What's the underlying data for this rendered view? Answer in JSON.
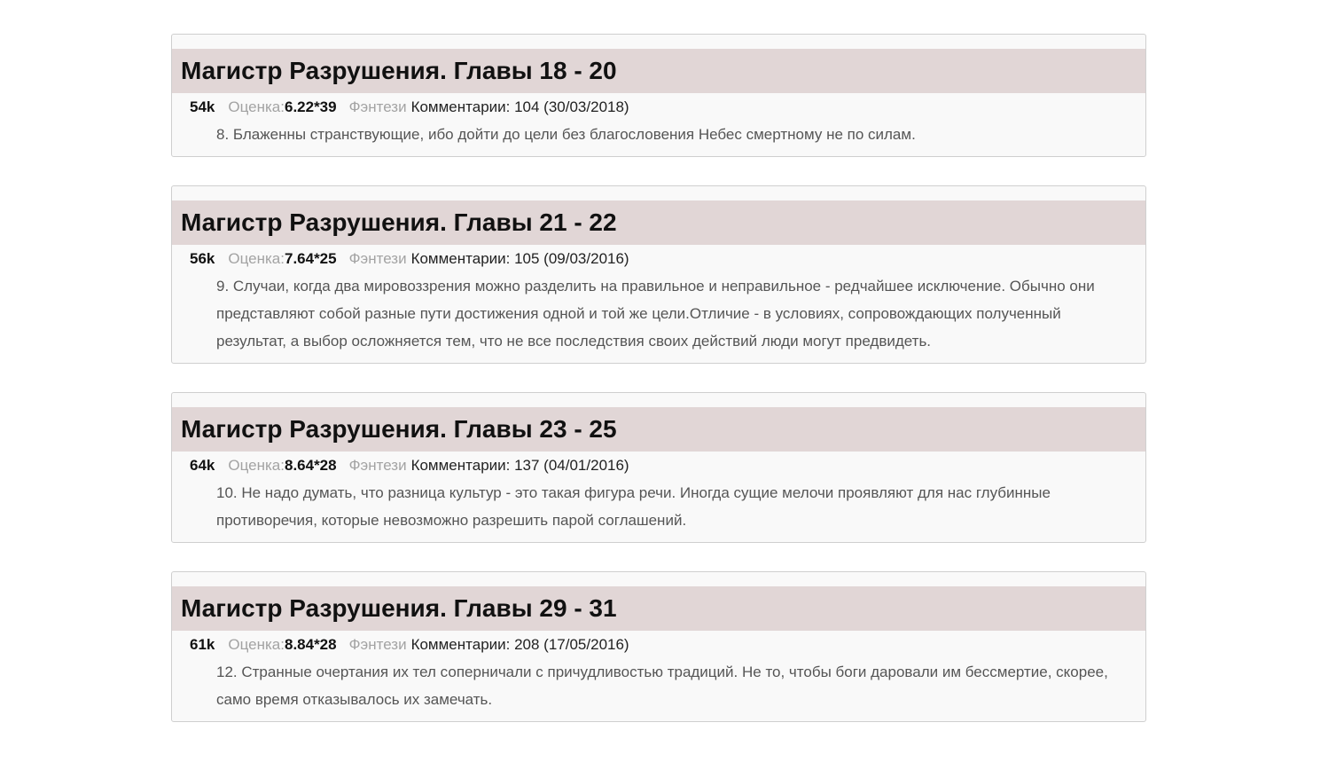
{
  "entries": [
    {
      "title": "Магистр Разрушения. Главы 18 - 20",
      "size": "54k",
      "rating_label": "Оценка:",
      "rating": "6.22*39",
      "genre": "Фэнтези",
      "comments": "Комментарии: 104 (30/03/2018)",
      "annotation": "8. Блаженны странствующие, ибо дойти до цели без благословения Небес смертному не по силам."
    },
    {
      "title": "Магистр Разрушения. Главы 21 - 22",
      "size": "56k",
      "rating_label": "Оценка:",
      "rating": "7.64*25",
      "genre": "Фэнтези",
      "comments": "Комментарии: 105 (09/03/2016)",
      "annotation": "9. Случаи, когда два мировоззрения можно разделить на правильное и неправильное - редчайшее исключение. Обычно они представляют собой разные пути достижения одной и той же цели.Отличие - в условиях, сопровождающих полученный результат, а выбор осложняется тем, что не все последствия своих действий люди могут предвидеть."
    },
    {
      "title": "Магистр Разрушения. Главы 23 - 25",
      "size": "64k",
      "rating_label": "Оценка:",
      "rating": "8.64*28",
      "genre": "Фэнтези",
      "comments": "Комментарии: 137 (04/01/2016)",
      "annotation": "10. Не надо думать, что разница культур - это такая фигура речи. Иногда сущие мелочи проявляют для нас глубинные противоречия, которые невозможно разрешить парой соглашений."
    },
    {
      "title": "Магистр Разрушения. Главы 29 - 31",
      "size": "61k",
      "rating_label": "Оценка:",
      "rating": "8.84*28",
      "genre": "Фэнтези",
      "comments": "Комментарии: 208 (17/05/2016)",
      "annotation": "12. Странные очертания их тел соперничали с причудливостью традиций. Не то, чтобы боги даровали им бессмертие, скорее, само время отказывалось их замечать."
    }
  ]
}
